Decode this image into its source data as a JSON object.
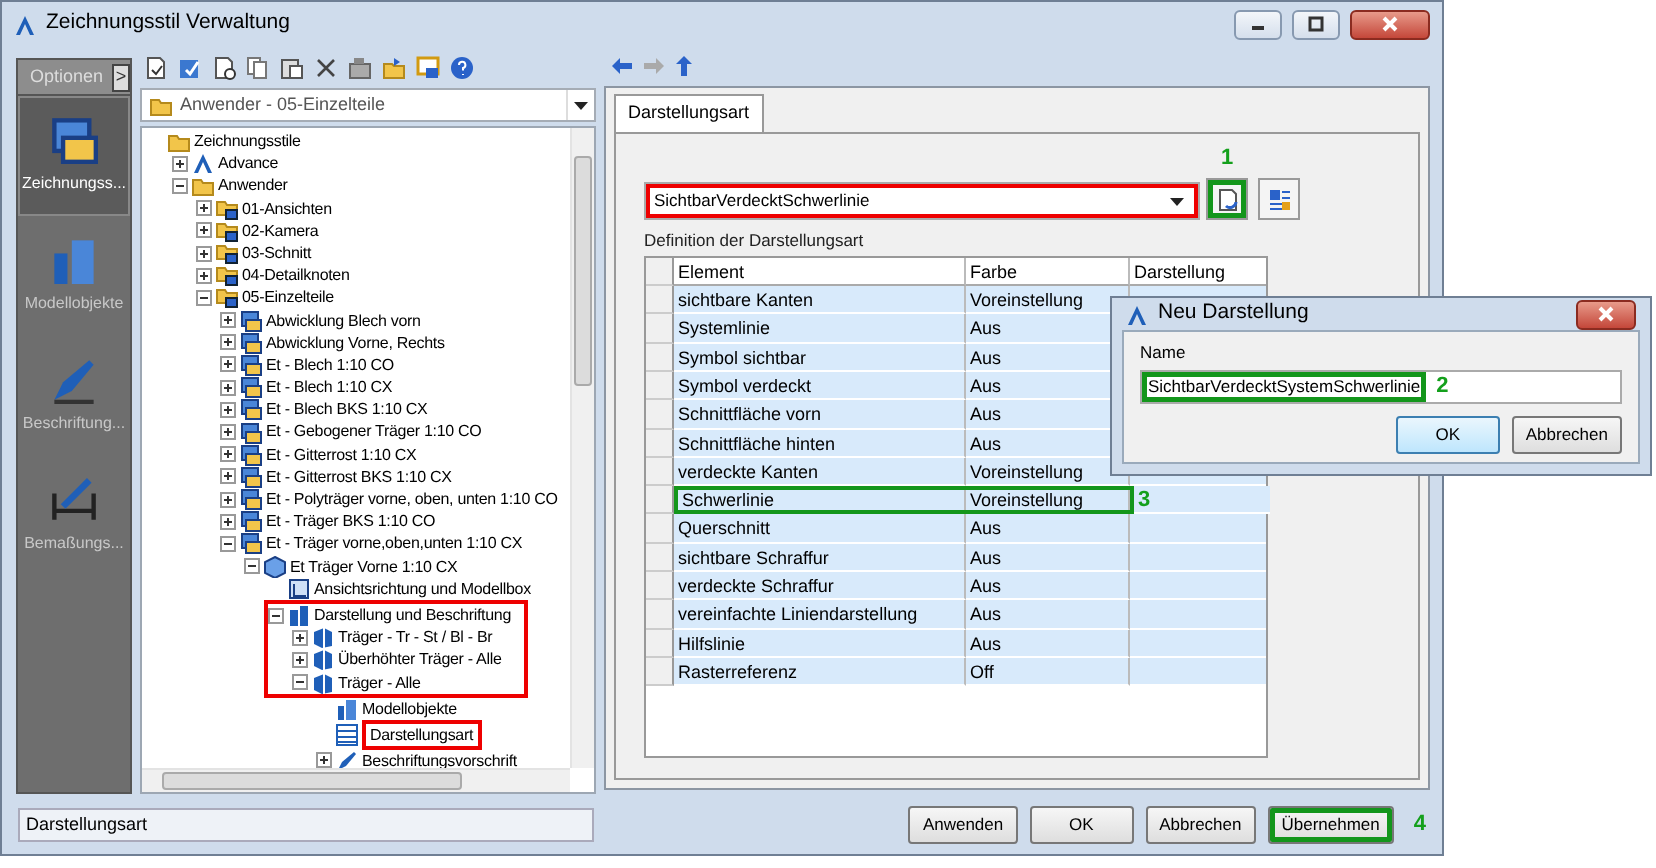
{
  "window": {
    "title": "Zeichnungsstil Verwaltung"
  },
  "sidebar": {
    "header": "Optionen",
    "header_arrow": ">",
    "items": [
      {
        "label": "Zeichnungss...",
        "kind": "styles",
        "selected": true
      },
      {
        "label": "Modellobjekte",
        "kind": "model",
        "selected": false
      },
      {
        "label": "Beschriftung...",
        "kind": "label",
        "selected": false
      },
      {
        "label": "Bemaßungs...",
        "kind": "dimension",
        "selected": false
      }
    ]
  },
  "style_selector": {
    "value": "Anwender - 05-Einzelteile"
  },
  "tree": {
    "items": [
      {
        "label": "Zeichnungsstile",
        "kind": "folder",
        "children": [
          {
            "label": "Advance",
            "kind": "logo",
            "expanded": false
          },
          {
            "label": "Anwender",
            "kind": "folder",
            "expanded": true,
            "children": [
              {
                "label": "01-Ansichten",
                "kind": "stylefolder",
                "expanded": false
              },
              {
                "label": "02-Kamera",
                "kind": "stylefolder",
                "expanded": false
              },
              {
                "label": "03-Schnitt",
                "kind": "stylefolder",
                "expanded": false
              },
              {
                "label": "04-Detailknoten",
                "kind": "stylefolder",
                "expanded": false
              },
              {
                "label": "05-Einzelteile",
                "kind": "stylefolder",
                "expanded": true,
                "children": [
                  {
                    "label": "Abwicklung Blech vorn",
                    "kind": "style",
                    "expanded": false
                  },
                  {
                    "label": "Abwicklung Vorne, Rechts",
                    "kind": "style",
                    "expanded": false
                  },
                  {
                    "label": "Et - Blech 1:10 CO",
                    "kind": "style",
                    "expanded": false
                  },
                  {
                    "label": "Et - Blech 1:10 CX",
                    "kind": "style",
                    "expanded": false
                  },
                  {
                    "label": "Et - Blech BKS 1:10 CX",
                    "kind": "style",
                    "expanded": false
                  },
                  {
                    "label": "Et - Gebogener Träger 1:10 CO",
                    "kind": "style",
                    "expanded": false
                  },
                  {
                    "label": "Et - Gitterrost 1:10 CX",
                    "kind": "style",
                    "expanded": false
                  },
                  {
                    "label": "Et - Gitterrost BKS 1:10 CX",
                    "kind": "style",
                    "expanded": false
                  },
                  {
                    "label": "Et - Polyträger vorne, oben, unten 1:10 CO",
                    "kind": "style",
                    "expanded": false
                  },
                  {
                    "label": "Et - Träger BKS 1:10 CO",
                    "kind": "style",
                    "expanded": false
                  },
                  {
                    "label": "Et - Träger vorne,oben,unten 1:10 CX",
                    "kind": "style",
                    "expanded": true,
                    "children": [
                      {
                        "label": "Et Träger Vorne 1:10 CX",
                        "kind": "part",
                        "expanded": true,
                        "children": [
                          {
                            "label": "Ansichtsrichtung und Modellbox",
                            "kind": "view"
                          },
                          {
                            "label": "Darstellung und Beschriftung",
                            "kind": "group",
                            "expanded": true,
                            "highlighted": true,
                            "children": [
                              {
                                "label": "Träger - Tr - St / Bl - Br",
                                "kind": "object",
                                "expanded": false
                              },
                              {
                                "label": "Überhöhter Träger - Alle",
                                "kind": "object",
                                "expanded": false
                              },
                              {
                                "label": "Träger - Alle",
                                "kind": "object",
                                "expanded": true,
                                "children": [
                                  {
                                    "label": "Modellobjekte",
                                    "kind": "model"
                                  },
                                  {
                                    "label": "Darstellungsart",
                                    "kind": "table",
                                    "highlighted": true
                                  },
                                  {
                                    "label": "Beschriftungsvorschrift",
                                    "kind": "label",
                                    "expanded": false
                                  }
                                ]
                              }
                            ]
                          }
                        ]
                      }
                    ]
                  }
                ]
              }
            ]
          }
        ]
      }
    ]
  },
  "status_bar": {
    "text": "Darstellungsart"
  },
  "tabs": [
    {
      "label": "Darstellungsart",
      "selected": true
    }
  ],
  "display_selector": {
    "value": "SichtbarVerdecktSchwerlinie",
    "highlighted": true
  },
  "new_button": {
    "highlighted": true,
    "callout": "1"
  },
  "group_label": "Definition der Darstellungsart",
  "table": {
    "columns": [
      "Element",
      "Farbe",
      "Darstellung"
    ],
    "rows": [
      {
        "element": "sichtbare Kanten",
        "farbe": "Voreinstellung"
      },
      {
        "element": "Systemlinie",
        "farbe": "Aus"
      },
      {
        "element": "Symbol sichtbar",
        "farbe": "Aus"
      },
      {
        "element": "Symbol verdeckt",
        "farbe": "Aus"
      },
      {
        "element": "Schnittfläche vorn",
        "farbe": "Aus"
      },
      {
        "element": "Schnittfläche hinten",
        "farbe": "Aus"
      },
      {
        "element": "verdeckte Kanten",
        "farbe": "Voreinstellung"
      },
      {
        "element": "Schwerlinie",
        "farbe": "Voreinstellung",
        "highlighted": true,
        "callout": "3"
      },
      {
        "element": "Querschnitt",
        "farbe": "Aus"
      },
      {
        "element": "sichtbare Schraffur",
        "farbe": "Aus"
      },
      {
        "element": "verdeckte Schraffur",
        "farbe": "Aus"
      },
      {
        "element": "vereinfachte Liniendarstellung",
        "farbe": "Aus"
      },
      {
        "element": "Hilfslinie",
        "farbe": "Aus"
      },
      {
        "element": "Rasterreferenz",
        "farbe": "Off"
      }
    ]
  },
  "dialog": {
    "title": "Neu Darstellung",
    "field_label": "Name",
    "field_value": "SichtbarVerdecktSystemSchwerlinie",
    "highlighted": true,
    "callout": "2",
    "buttons": [
      {
        "label": "OK",
        "default": true
      },
      {
        "label": "Abbrechen",
        "default": false
      }
    ]
  },
  "buttons": [
    {
      "label": "Anwenden",
      "highlighted": false
    },
    {
      "label": "OK",
      "highlighted": false
    },
    {
      "label": "Abbrechen",
      "highlighted": false
    },
    {
      "label": "Übernehmen",
      "highlighted": true,
      "callout": "4"
    }
  ]
}
